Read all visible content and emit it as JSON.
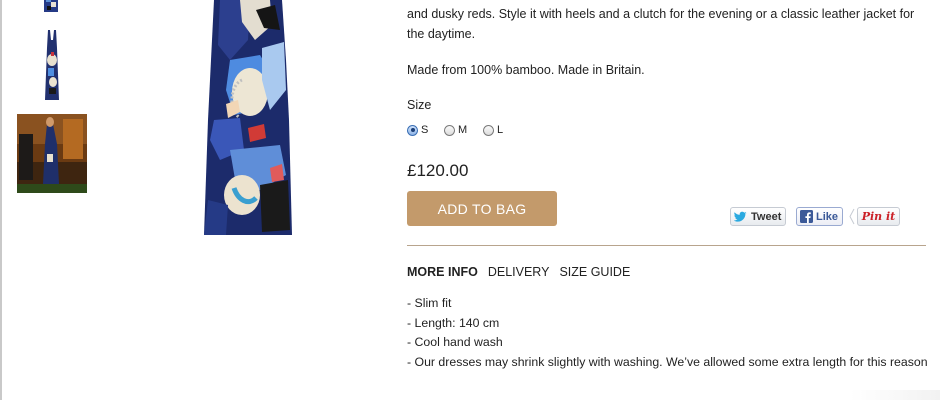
{
  "product": {
    "description": "and dusky reds. Style it with heels and a clutch for the evening or a classic leather jacket for the daytime.",
    "material": "Made from 100% bamboo. Made in Britain.",
    "size_label": "Size",
    "sizes": [
      {
        "label": "S",
        "checked": true
      },
      {
        "label": "M",
        "checked": false
      },
      {
        "label": "L",
        "checked": false
      }
    ],
    "price": "£120.00",
    "add_to_bag": "ADD TO BAG"
  },
  "social": {
    "tweet": "Tweet",
    "like": "Like",
    "pinit": "Pin it"
  },
  "tabs": [
    {
      "label": "MORE INFO",
      "active": true
    },
    {
      "label": "DELIVERY",
      "active": false
    },
    {
      "label": "SIZE GUIDE",
      "active": false
    }
  ],
  "more_info": [
    "- Slim fit",
    "- Length: 140 cm",
    "- Cool hand wash",
    "- Our dresses may shrink slightly with washing. We’ve allowed some extra length for this reason"
  ],
  "colors": {
    "button": "#c39a6b",
    "divider": "#b8a48d",
    "radio_checked": "#3a6fb5",
    "facebook": "#3b5998",
    "pinterest": "#cb2027",
    "twitter": "#2aa9e0"
  }
}
